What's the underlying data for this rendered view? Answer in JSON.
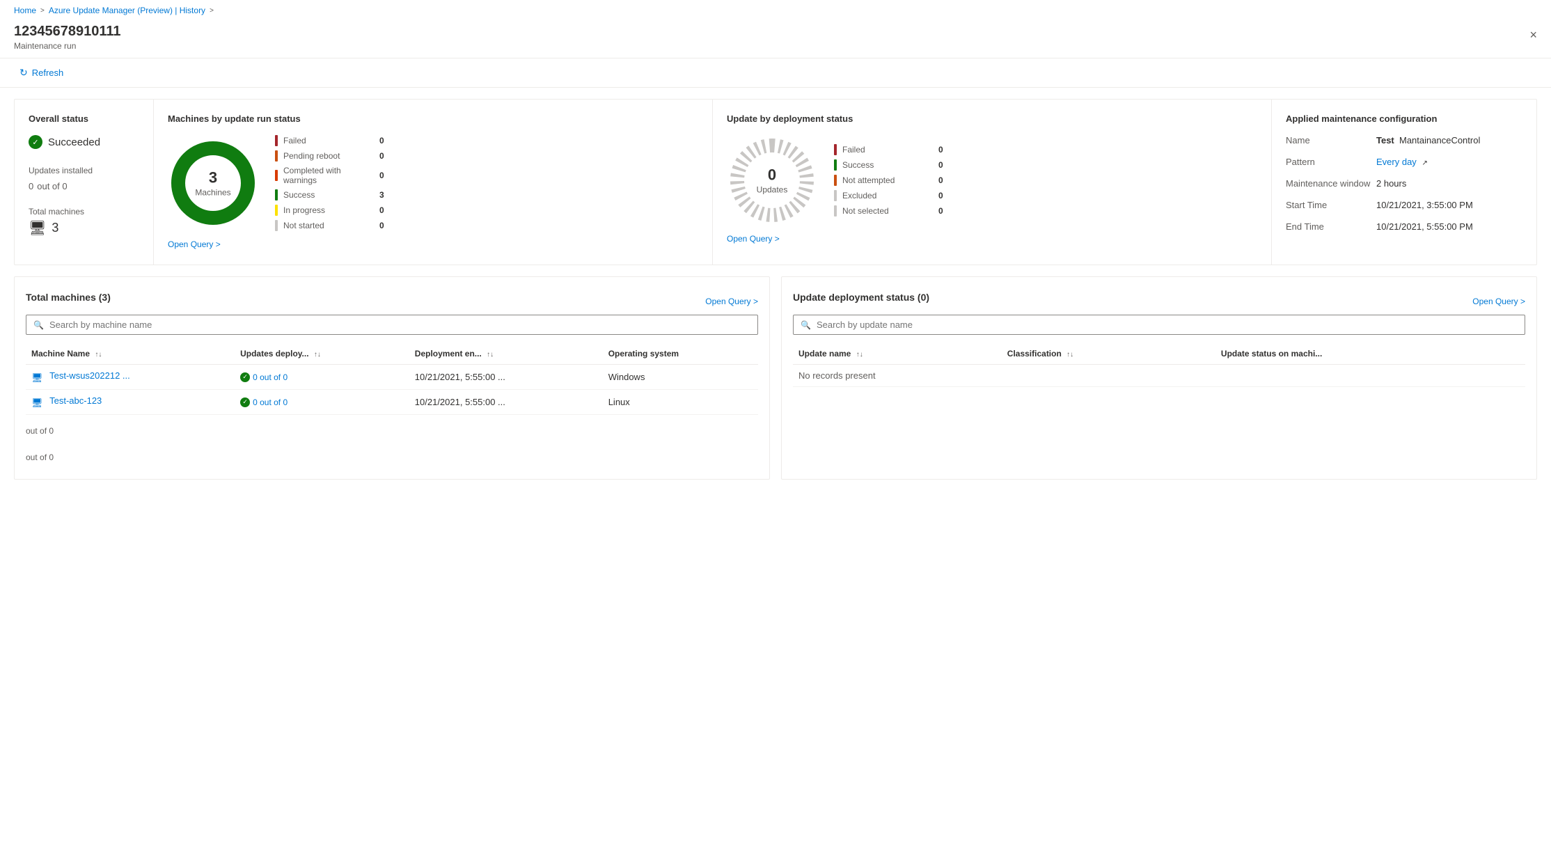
{
  "breadcrumb": {
    "home": "Home",
    "parent": "Azure Update Manager (Preview) | History",
    "sep": ">"
  },
  "header": {
    "title": "12345678910111",
    "subtitle": "Maintenance run",
    "close_label": "×"
  },
  "toolbar": {
    "refresh_label": "Refresh"
  },
  "overall_status": {
    "section_title": "Overall status",
    "status": "Succeeded",
    "updates_installed_label": "Updates installed",
    "updates_value": "0",
    "updates_suffix": "out of 0",
    "total_machines_label": "Total machines",
    "total_machines_value": "3"
  },
  "machines_chart": {
    "section_title": "Machines by update run status",
    "donut_number": "3",
    "donut_text": "Machines",
    "open_query": "Open Query >",
    "legend": [
      {
        "label": "Failed",
        "value": "0",
        "color": "#a4262c"
      },
      {
        "label": "Pending reboot",
        "value": "0",
        "color": "#ca5010"
      },
      {
        "label": "Completed with warnings",
        "value": "0",
        "color": "#d83b01"
      },
      {
        "label": "Success",
        "value": "3",
        "color": "#107c10"
      },
      {
        "label": "In progress",
        "value": "0",
        "color": "#fce100"
      },
      {
        "label": "Not started",
        "value": "0",
        "color": "#c8c6c4"
      }
    ]
  },
  "updates_chart": {
    "section_title": "Update by deployment status",
    "donut_number": "0",
    "donut_text": "Updates",
    "open_query": "Open Query >",
    "legend": [
      {
        "label": "Failed",
        "value": "0",
        "color": "#a4262c"
      },
      {
        "label": "Success",
        "value": "0",
        "color": "#107c10"
      },
      {
        "label": "Not attempted",
        "value": "0",
        "color": "#ca5010"
      },
      {
        "label": "Excluded",
        "value": "0",
        "color": "#c8c6c4"
      },
      {
        "label": "Not selected",
        "value": "0",
        "color": "#c8c6c4"
      }
    ]
  },
  "config": {
    "section_title": "Applied maintenance configuration",
    "name_label": "Name",
    "name_prefix": "Test",
    "name_value": "MantainanceControl",
    "pattern_label": "Pattern",
    "pattern_value": "Every day",
    "maintenance_window_label": "Maintenance window",
    "maintenance_window_value": "2 hours",
    "start_time_label": "Start Time",
    "start_time_value": "10/21/2021, 3:55:00 PM",
    "end_time_label": "End Time",
    "end_time_value": "10/21/2021, 5:55:00 PM"
  },
  "machines_table": {
    "title": "Total machines (3)",
    "open_query": "Open Query >",
    "search_placeholder": "Search by machine name",
    "columns": [
      {
        "label": "Machine Name",
        "sortable": true
      },
      {
        "label": "Updates deploy...",
        "sortable": true
      },
      {
        "label": "Deployment en...",
        "sortable": true
      },
      {
        "label": "Operating system",
        "sortable": false
      }
    ],
    "rows": [
      {
        "machine": "Test-wsus202212 ...",
        "updates": "0 out of 0",
        "deployment_end": "10/21/2021, 5:55:00 ...",
        "os": "Windows"
      },
      {
        "machine": "Test-abc-123",
        "updates": "0 out of 0",
        "deployment_end": "10/21/2021, 5:55:00 ...",
        "os": "Linux"
      }
    ],
    "pagination": {
      "out_of_label_1": "out of 0",
      "out_of_label_2": "out of 0"
    }
  },
  "updates_table": {
    "title": "Update deployment status (0)",
    "open_query": "Open Query >",
    "search_placeholder": "Search by update name",
    "columns": [
      {
        "label": "Update name",
        "sortable": true
      },
      {
        "label": "Classification",
        "sortable": true
      },
      {
        "label": "Update status on machi...",
        "sortable": false
      }
    ],
    "no_records": "No records present"
  },
  "colors": {
    "primary_blue": "#0078d4",
    "success_green": "#107c10",
    "border": "#edebe9"
  }
}
